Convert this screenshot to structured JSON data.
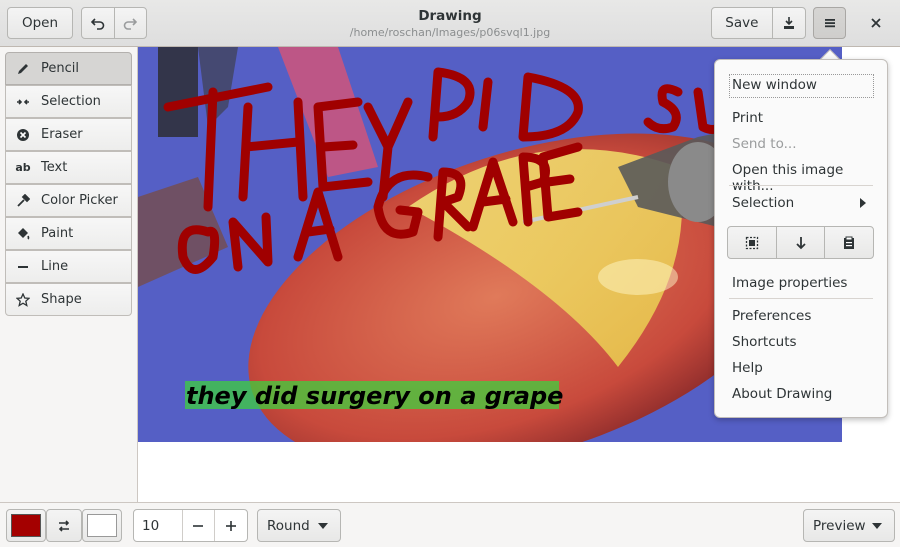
{
  "header": {
    "open_label": "Open",
    "title": "Drawing",
    "subtitle": "/home/roschan/Images/p06svql1.jpg",
    "save_label": "Save"
  },
  "tools": [
    {
      "label": "Pencil",
      "icon": "pencil-icon",
      "active": true
    },
    {
      "label": "Selection",
      "icon": "selection-icon"
    },
    {
      "label": "Eraser",
      "icon": "eraser-icon"
    },
    {
      "label": "Text",
      "icon": "text-icon"
    },
    {
      "label": "Color Picker",
      "icon": "color-picker-icon"
    },
    {
      "label": "Paint",
      "icon": "paint-icon"
    },
    {
      "label": "Line",
      "icon": "line-icon"
    },
    {
      "label": "Shape",
      "icon": "shape-icon"
    }
  ],
  "image": {
    "handwriting_1": "THEY DID",
    "handwriting_2": "ON A GRAPE",
    "handwriting_3": "SU",
    "caption": "they did surgery on a grape"
  },
  "menu": {
    "new_window": "New window",
    "print": "Print",
    "send_to": "Send to...",
    "open_with": "Open this image with...",
    "selection": "Selection",
    "image_properties": "Image properties",
    "preferences": "Preferences",
    "shortcuts": "Shortcuts",
    "help": "Help",
    "about": "About Drawing"
  },
  "bottom": {
    "main_color": "#a40000",
    "secondary_color": "#ffffff",
    "size_value": "10",
    "shape_option": "Round",
    "preview_label": "Preview"
  }
}
